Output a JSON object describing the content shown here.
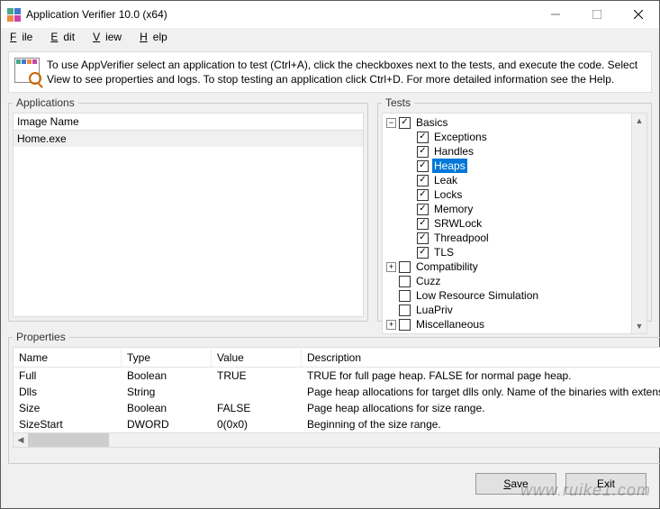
{
  "window": {
    "title": "Application Verifier 10.0 (x64)"
  },
  "menu": {
    "file_u": "F",
    "file_r": "ile",
    "edit_u": "E",
    "edit_r": "dit",
    "view_u": "V",
    "view_r": "iew",
    "help_u": "H",
    "help_r": "elp"
  },
  "info": {
    "message": "To use AppVerifier select an application to test (Ctrl+A), click the checkboxes next to the tests, and execute the code. Select View to see properties and logs. To stop testing an application click Ctrl+D. For more detailed information see the Help."
  },
  "applications": {
    "legend": "Applications",
    "header": "Image Name",
    "items": [
      "Home.exe"
    ]
  },
  "tests": {
    "legend": "Tests",
    "tree": [
      {
        "label": "Basics",
        "checked": true,
        "expanded": true,
        "children": [
          "Exceptions",
          "Handles",
          "Heaps",
          "Leak",
          "Locks",
          "Memory",
          "SRWLock",
          "Threadpool",
          "TLS"
        ]
      },
      {
        "label": "Compatibility",
        "checked": false,
        "expanded": false
      },
      {
        "label": "Cuzz",
        "checked": false
      },
      {
        "label": "Low Resource Simulation",
        "checked": false
      },
      {
        "label": "LuaPriv",
        "checked": false
      },
      {
        "label": "Miscellaneous",
        "checked": false,
        "expanded": false
      }
    ],
    "selected": "Heaps"
  },
  "properties": {
    "legend": "Properties",
    "headers": [
      "Name",
      "Type",
      "Value",
      "Description"
    ],
    "rows": [
      {
        "name": "Full",
        "type": "Boolean",
        "value": "TRUE",
        "desc": "TRUE for full page heap. FALSE for normal page heap."
      },
      {
        "name": "Dlls",
        "type": "String",
        "value": "",
        "desc": "Page heap allocations for target dlls only. Name of the binaries with extens.."
      },
      {
        "name": "Size",
        "type": "Boolean",
        "value": "FALSE",
        "desc": "Page heap allocations for size range."
      },
      {
        "name": "SizeStart",
        "type": "DWORD",
        "value": "0(0x0)",
        "desc": "Beginning of the size range."
      }
    ]
  },
  "buttons": {
    "save_u": "S",
    "save_r": "ave",
    "exit": "Exit"
  },
  "watermark": "www.ruike1.com"
}
